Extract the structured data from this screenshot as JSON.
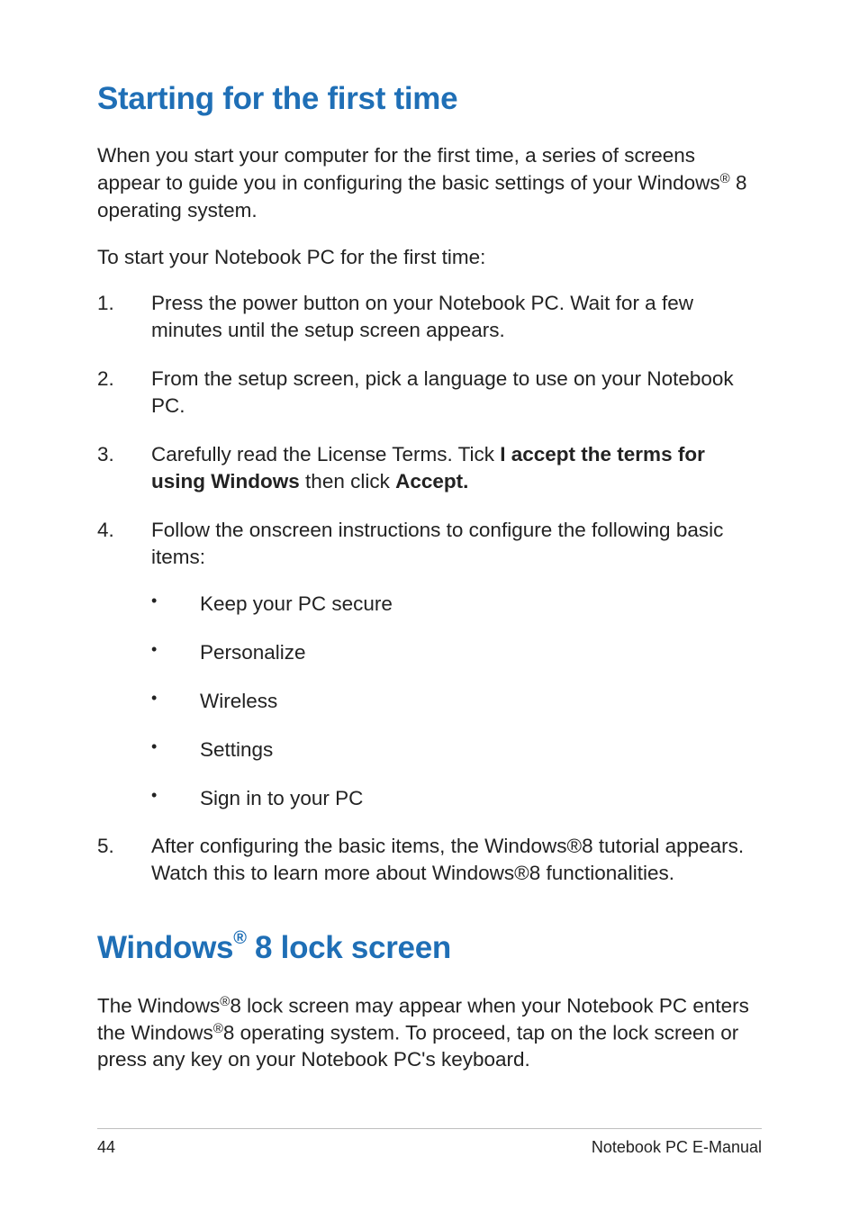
{
  "section1": {
    "title": "Starting for the first time",
    "para1_a": "When you start your computer for the first time, a series of screens appear to guide you in configuring the basic settings of your Windows",
    "para1_reg": "®",
    "para1_b": " 8 operating system.",
    "para2": "To start your Notebook PC for the first time:",
    "steps": {
      "s1": "Press the power button on your Notebook PC. Wait for a few minutes until the setup screen appears.",
      "s2": "From the setup screen, pick a language to use on your Notebook PC.",
      "s3_a": "Carefully read the License Terms. Tick ",
      "s3_b": "I accept the terms for using Windows",
      "s3_c": " then click ",
      "s3_d": "Accept.",
      "s4": "Follow the onscreen instructions to configure the following basic items:",
      "s4_items": {
        "i1": "Keep your PC secure",
        "i2": "Personalize",
        "i3": "Wireless",
        "i4": "Settings",
        "i5": "Sign in to your PC"
      },
      "s5_a": "After configuring the basic items, the Windows",
      "s5_reg1": "®",
      "s5_b": "8 tutorial appears. Watch this to learn more about Windows",
      "s5_reg2": "®",
      "s5_c": "8 functionalities."
    }
  },
  "section2": {
    "title_a": "Windows",
    "title_reg": "®",
    "title_b": " 8 lock screen",
    "para_a": "The Windows",
    "para_reg1": "®",
    "para_b": "8 lock screen may appear when your Notebook PC enters the Windows",
    "para_reg2": "®",
    "para_c": "8 operating system. To proceed,  tap on the lock screen or press any key on your Notebook PC's keyboard."
  },
  "footer": {
    "page": "44",
    "doc": "Notebook PC E-Manual"
  }
}
